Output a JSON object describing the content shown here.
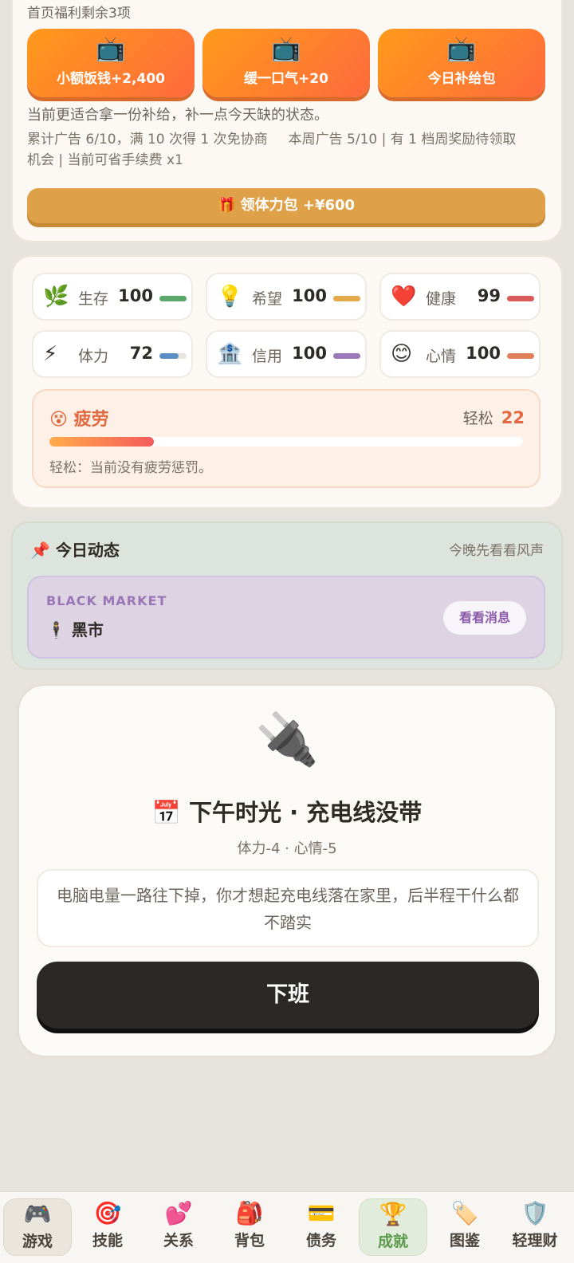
{
  "welfare": {
    "title": "首页福利剩余3项",
    "ads": [
      {
        "icon": "📺",
        "label": "小额饭钱+2,400"
      },
      {
        "icon": "📺",
        "label": "缓一口气+20"
      },
      {
        "icon": "📺",
        "label": "今日补给包"
      }
    ],
    "desc": "当前更适合拿一份补给，补一点今天缺的状态。",
    "stat_ad": "累计广告 6/10，满 10 次得 1 次免协商",
    "stat_week": "本周广告 5/10 | 有 1 档周奖励待领取",
    "stat_chance": "机会 | 当前可省手续费 x1",
    "energy_button": "🎁 领体力包 +¥600"
  },
  "stats": [
    {
      "icon": "🌿",
      "name": "生存",
      "value": 100,
      "level": 1.0,
      "color": "#5aa86a"
    },
    {
      "icon": "💡",
      "name": "希望",
      "value": 100,
      "level": 1.0,
      "color": "#e3a94a"
    },
    {
      "icon": "❤️",
      "name": "健康",
      "value": 99,
      "level": 0.99,
      "color": "#d95a5a"
    },
    {
      "icon": "⚡",
      "name": "体力",
      "value": 72,
      "level": 0.72,
      "color": "#5b8fc4"
    },
    {
      "icon": "🏦",
      "name": "信用",
      "value": 100,
      "level": 1.0,
      "color": "#9b78b8"
    },
    {
      "icon": "😊",
      "name": "心情",
      "value": 100,
      "level": 1.0,
      "color": "#e0805a"
    }
  ],
  "fatigue": {
    "icon": "😵",
    "title": "疲劳",
    "level_label": "轻松",
    "level_value": "22",
    "level": 0.22,
    "desc": "轻松：当前没有疲劳惩罚。"
  },
  "news": {
    "icon": "📌",
    "title": "今日动态",
    "subtitle": "今晚先看看风声",
    "item_en": "BLACK MARKET",
    "item_icon": "🕴",
    "item_cn": "黑市",
    "item_button": "看看消息"
  },
  "event": {
    "icon": "🔌",
    "title_icon": "📅",
    "title": "下午时光 · 充电线没带",
    "effect": "体力-4 · 心情-5",
    "desc": "电脑电量一路往下掉，你才想起充电线落在家里，后半程干什么都不踏实",
    "button": "下班"
  },
  "nav": [
    {
      "icon": "🎮",
      "label": "游戏"
    },
    {
      "icon": "🎯",
      "label": "技能"
    },
    {
      "icon": "💕",
      "label": "关系"
    },
    {
      "icon": "🎒",
      "label": "背包"
    },
    {
      "icon": "💳",
      "label": "债务"
    },
    {
      "icon": "🏆",
      "label": "成就"
    },
    {
      "icon": "🏷️",
      "label": "图鉴"
    },
    {
      "icon": "🛡️",
      "label": "轻理财"
    }
  ]
}
